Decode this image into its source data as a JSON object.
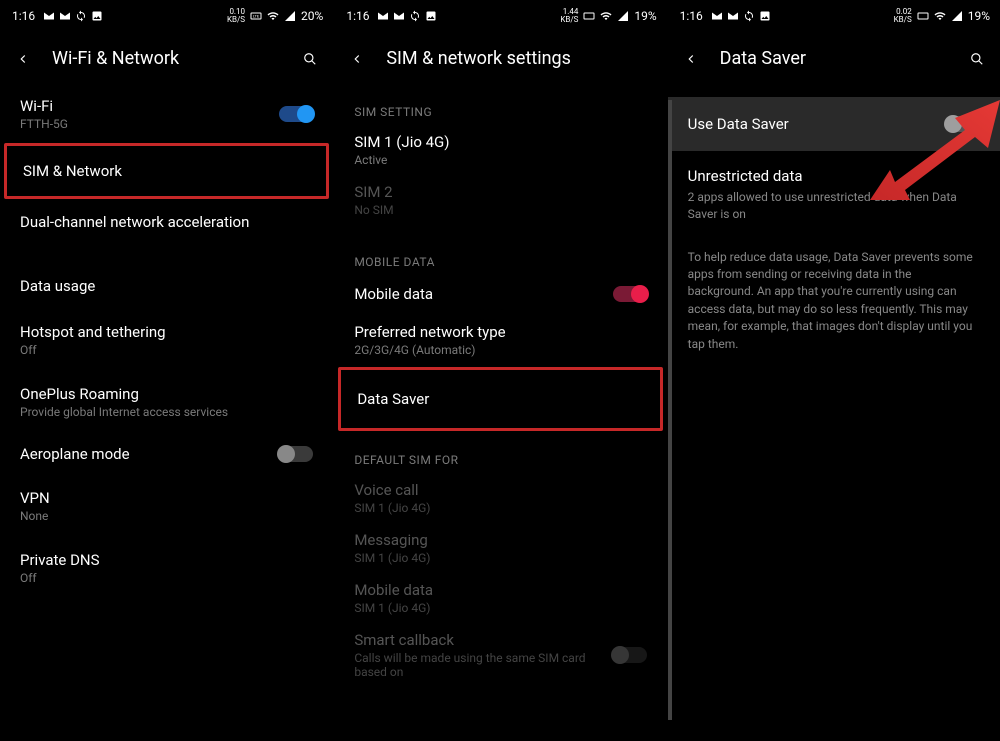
{
  "status": {
    "time": "1:16",
    "p1_kbs": "0.10\nKB/S",
    "p1_batt": "20%",
    "p2_kbs": "1.44\nKB/S",
    "p2_batt": "19%",
    "p3_kbs": "0.02\nKB/S",
    "p3_batt": "19%"
  },
  "panel1": {
    "title": "Wi-Fi & Network",
    "wifi": {
      "label": "Wi-Fi",
      "sub": "FTTH-5G"
    },
    "sim_network": {
      "label": "SIM & Network"
    },
    "dual_channel": {
      "label": "Dual-channel network acceleration"
    },
    "data_usage": {
      "label": "Data usage"
    },
    "hotspot": {
      "label": "Hotspot and tethering",
      "sub": "Off"
    },
    "roaming": {
      "label": "OnePlus Roaming",
      "sub": "Provide global Internet access services"
    },
    "airplane": {
      "label": "Aeroplane mode"
    },
    "vpn": {
      "label": "VPN",
      "sub": "None"
    },
    "dns": {
      "label": "Private DNS",
      "sub": "Off"
    }
  },
  "panel2": {
    "title": "SIM & network settings",
    "sim_setting": "SIM SETTING",
    "sim1": {
      "label": "SIM 1 (Jio 4G)",
      "sub": "Active"
    },
    "sim2": {
      "label": "SIM 2",
      "sub": "No SIM"
    },
    "mobile_data_hdr": "MOBILE DATA",
    "mobile_data": {
      "label": "Mobile data"
    },
    "pref_net": {
      "label": "Preferred network type",
      "sub": "2G/3G/4G (Automatic)"
    },
    "data_saver": {
      "label": "Data Saver"
    },
    "default_sim": "DEFAULT SIM FOR",
    "voice": {
      "label": "Voice call",
      "sub": "SIM 1 (Jio 4G)"
    },
    "messaging": {
      "label": "Messaging",
      "sub": "SIM 1 (Jio 4G)"
    },
    "md_default": {
      "label": "Mobile data",
      "sub": "SIM 1 (Jio 4G)"
    },
    "smart_cb": {
      "label": "Smart callback",
      "sub": "Calls will be made using the same SIM card based on"
    }
  },
  "panel3": {
    "title": "Data Saver",
    "use_ds": {
      "label": "Use Data Saver"
    },
    "unrestricted": {
      "label": "Unrestricted data",
      "sub": "2 apps allowed to use unrestricted data when Data Saver is on"
    },
    "help": "To help reduce data usage, Data Saver prevents some apps from sending or receiving data in the background. An app that you're currently using can access data, but may do so less frequently. This may mean, for example, that images don't display until you tap them."
  }
}
